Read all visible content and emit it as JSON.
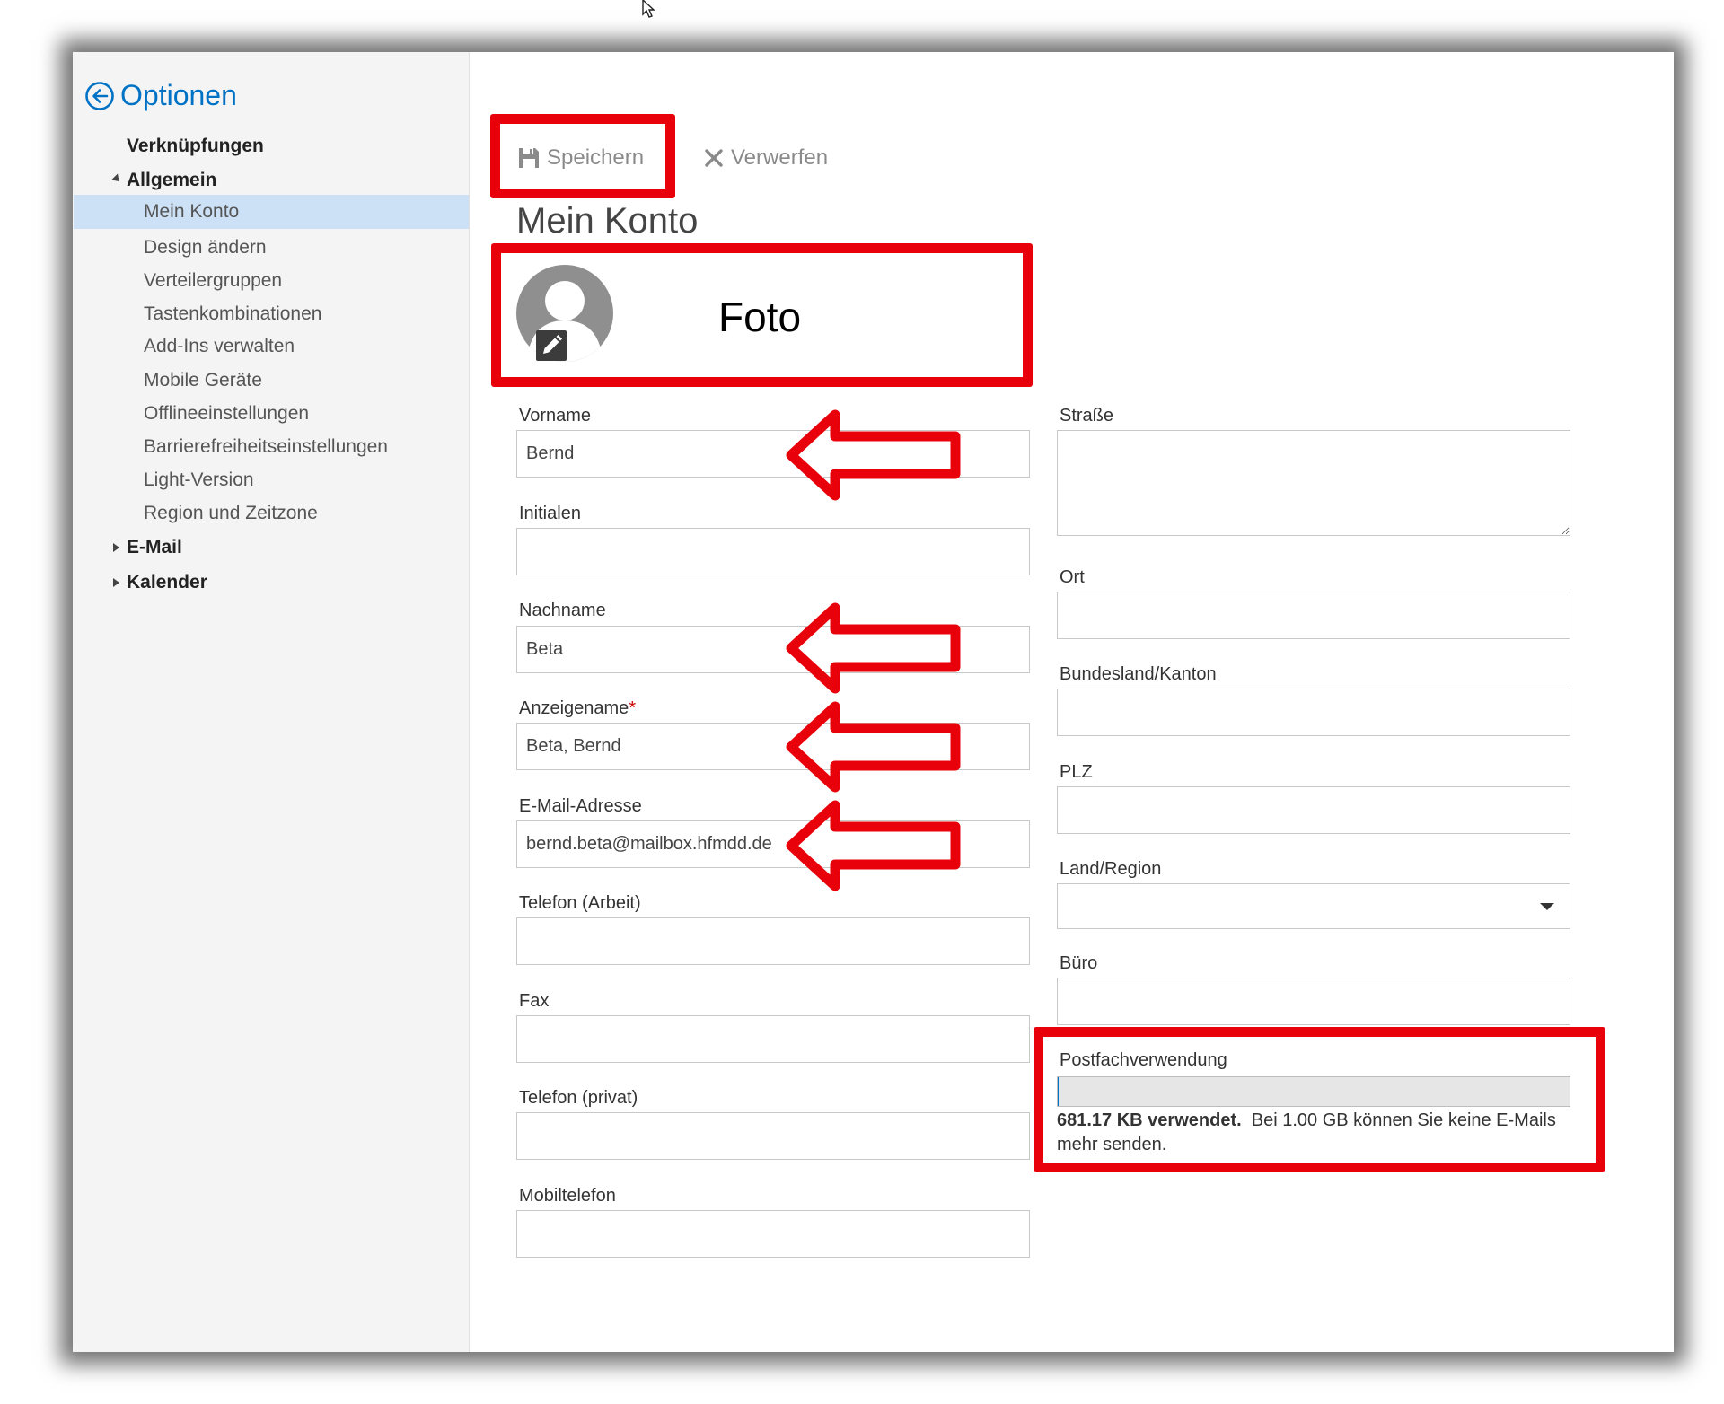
{
  "sidebar": {
    "title": "Optionen",
    "items": [
      {
        "label": "Verknüpfungen"
      },
      {
        "label": "Allgemein"
      },
      {
        "label": "Mein Konto"
      },
      {
        "label": "Design ändern"
      },
      {
        "label": "Verteilergruppen"
      },
      {
        "label": "Tastenkombinationen"
      },
      {
        "label": "Add-Ins verwalten"
      },
      {
        "label": "Mobile Geräte"
      },
      {
        "label": "Offlineeinstellungen"
      },
      {
        "label": "Barrierefreiheitseinstellungen"
      },
      {
        "label": "Light-Version"
      },
      {
        "label": "Region und Zeitzone"
      },
      {
        "label": "E-Mail"
      },
      {
        "label": "Kalender"
      }
    ]
  },
  "toolbar": {
    "save_label": "Speichern",
    "discard_label": "Verwerfen"
  },
  "page": {
    "title": "Mein Konto"
  },
  "photo": {
    "annotation": "Foto"
  },
  "left_fields": {
    "vorname": {
      "label": "Vorname",
      "value": "Bernd"
    },
    "initialen": {
      "label": "Initialen",
      "value": ""
    },
    "nachname": {
      "label": "Nachname",
      "value": "Beta"
    },
    "anzeigename": {
      "label": "Anzeigename",
      "required_mark": "*",
      "value": "Beta, Bernd"
    },
    "email": {
      "label": "E-Mail-Adresse",
      "value": "bernd.beta@mailbox.hfmdd.de"
    },
    "telefon_arbeit": {
      "label": "Telefon (Arbeit)",
      "value": ""
    },
    "fax": {
      "label": "Fax",
      "value": ""
    },
    "telefon_privat": {
      "label": "Telefon (privat)",
      "value": ""
    },
    "mobiltelefon": {
      "label": "Mobiltelefon",
      "value": ""
    }
  },
  "right_fields": {
    "strasse": {
      "label": "Straße",
      "value": ""
    },
    "ort": {
      "label": "Ort",
      "value": ""
    },
    "bundesland": {
      "label": "Bundesland/Kanton",
      "value": ""
    },
    "plz": {
      "label": "PLZ",
      "value": ""
    },
    "land": {
      "label": "Land/Region",
      "value": ""
    },
    "buero": {
      "label": "Büro",
      "value": ""
    }
  },
  "mailbox": {
    "label": "Postfachverwendung",
    "used": "681.17 KB verwendet.",
    "limit_text": "Bei 1.00 GB können Sie keine E-Mails mehr senden.",
    "usage_fraction": 0.0007
  },
  "colors": {
    "accent": "#0072c6",
    "annotation_red": "#e8000b",
    "selected_bg": "#cce1f6"
  },
  "icons": {
    "back": "back-arrow-circle-icon",
    "save": "floppy-disk-icon",
    "discard": "x-icon",
    "edit": "pencil-icon",
    "dropdown": "caret-down-icon",
    "cursor": "mouse-pointer-icon"
  }
}
